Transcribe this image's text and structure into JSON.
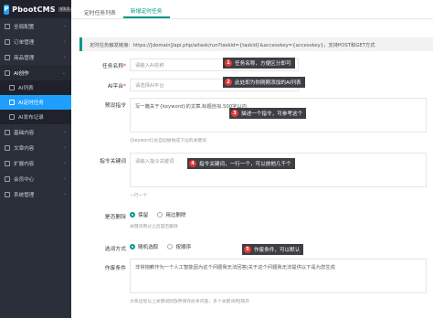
{
  "app": {
    "logo_mark": "P",
    "name": "PbootCMS",
    "version": "V3.1"
  },
  "sidebar": {
    "items": [
      {
        "label": "全局配置",
        "icon": "gear-icon"
      },
      {
        "label": "订单管理",
        "icon": "cart-icon"
      },
      {
        "label": "商品管理",
        "icon": "box-icon"
      },
      {
        "label": "AI创作",
        "icon": "robot-icon"
      },
      {
        "label": "AI列表",
        "icon": "list-icon"
      },
      {
        "label": "AI定时任务",
        "icon": "clock-icon"
      },
      {
        "label": "AI发布记录",
        "icon": "record-icon"
      },
      {
        "label": "基础内容",
        "icon": "file-icon"
      },
      {
        "label": "文章内容",
        "icon": "doc-icon"
      },
      {
        "label": "扩展内容",
        "icon": "puzzle-icon"
      },
      {
        "label": "会员中心",
        "icon": "user-icon"
      },
      {
        "label": "系统管理",
        "icon": "settings-icon"
      }
    ]
  },
  "tabs": [
    {
      "label": "定时任务列表"
    },
    {
      "label": "新增定时任务"
    }
  ],
  "notice": "定时任务触发链接：https://[domain]/api.php/aitask/run?taskid={taskid}&accesskey={accesskey}，支持POST和GET方式",
  "form": {
    "task_name": {
      "label": "任务名称",
      "required": "*",
      "placeholder": "请输入AI名称"
    },
    "ai_platform": {
      "label": "AI平台",
      "required": "*",
      "placeholder": "请选择AI平台"
    },
    "preset_prompt": {
      "label": "预设指令",
      "value": "写一篇关于{keyword}的文章,标题自拟,500字以内",
      "hint": "{keyword}会自动替换成下边的关键词"
    },
    "prompt_keywords": {
      "label": "指令关键词",
      "placeholder": "请输入指令关键词",
      "hint": "一行一个"
    },
    "delete": {
      "label": "是否删除",
      "options": [
        "保留",
        "用过删除"
      ],
      "selected": 0,
      "hint": "关键词用过之后是否删除"
    },
    "method": {
      "label": "选词方式",
      "options": [
        "随机选取",
        "按顺序"
      ],
      "selected": 0
    },
    "condition": {
      "label": "作废条件",
      "value": "非常抱歉作为一个人工智能因为这个问题我无法回答|关于这个问题我无法提供以下是为您生成",
      "hint": "文章出现以上关键词则放弃保存此条内容，多个关键词用|隔开"
    }
  },
  "callouts": [
    {
      "num": "1",
      "text": "任务名称，方便区分即可"
    },
    {
      "num": "2",
      "text": "此处即为你刚刚添加的AI列表"
    },
    {
      "num": "3",
      "text": "描述一个指令，可参考这个"
    },
    {
      "num": "4",
      "text": "指令关键词，一行一个，可以放他几千个"
    },
    {
      "num": "5",
      "text": "作废条件，可以默认"
    }
  ],
  "colors": {
    "sidebar_bg": "#2b2f3a",
    "accent": "#009688",
    "active_nav": "#1e9fff",
    "callout_badge": "#e53935"
  }
}
